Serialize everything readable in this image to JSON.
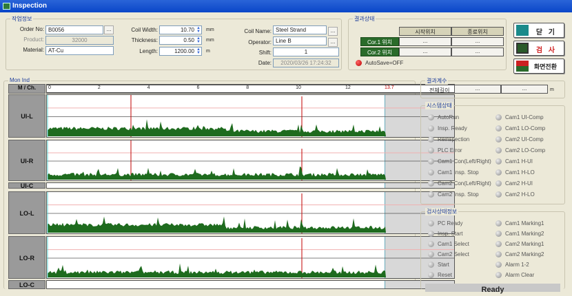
{
  "window": {
    "title": "Inspection"
  },
  "work_info": {
    "title": "작업정보",
    "order_no_label": "Order No:",
    "order_no": "B0056",
    "product_label": "Product:",
    "product": "32000",
    "material_label": "Material:",
    "material": "AT-Cu",
    "width_label": "Coil Width:",
    "width": "10.70",
    "width_unit": "mm",
    "thickness_label": "Thickness:",
    "thickness": "0.50",
    "thickness_unit": "mm",
    "length_label": "Length:",
    "length": "1200.00",
    "length_unit": "m",
    "coil_name_label": "Coil Name:",
    "coil_name": "Steel Strand",
    "operator_label": "Operator:",
    "operator": "Line B",
    "shift_label": "Shift:",
    "shift": "1",
    "date_label": "Date:",
    "date": "2020/03/26 17:24:32",
    "more": "..."
  },
  "result_status": {
    "title": "결과상태",
    "col1": "시작위치",
    "col2": "종료위치",
    "rows": [
      {
        "label": "Cor.1 위치",
        "v1": "...",
        "v2": "..."
      },
      {
        "label": "Cor.2 위치",
        "v1": "...",
        "v2": "..."
      }
    ],
    "indicator": "AutoSave=OFF",
    "indicator_color": "#cc0000"
  },
  "buttons": {
    "close": "닫 기",
    "inspect": "검 사",
    "switch": "화면전환"
  },
  "result_count": {
    "title": "결과계수",
    "label": "전체길이",
    "v1": "...",
    "v2": "...",
    "unit": "m"
  },
  "graph": {
    "title": "Mon Ind",
    "axis_label": "M / Ch.",
    "ticks": [
      "0",
      "2",
      "4",
      "6",
      "8",
      "10",
      "12"
    ],
    "end_tick": "13.7",
    "channels": [
      "UI-L",
      "UI-R",
      "UI-C",
      "LO-L",
      "LO-R",
      "LO-C"
    ],
    "color": "#1e6b1e",
    "marker_color": "#c00000"
  },
  "system_status": {
    "title": "시스템상태",
    "left": [
      "AutoRun",
      "Insp. Ready",
      "Reinspection",
      "PLC Error",
      "Cam1 Con(Left/Right)",
      "Cam1 Insp. Stop",
      "Cam2 Con(Left/Right)",
      "Cam2 Insp. Stop"
    ],
    "right": [
      "Cam1 UI-Comp",
      "Cam1 LO-Comp",
      "Cam2 UI-Comp",
      "Cam2 LO-Comp",
      "Cam1 H-UI",
      "Cam1 H-LO",
      "Cam2 H-UI",
      "Cam2 H-LO"
    ]
  },
  "insp_status": {
    "title": "검사상태정보",
    "left": [
      "PC Ready",
      "Insp. Start",
      "Cam1 Select",
      "Cam2 Select",
      "Start",
      "Reset"
    ],
    "right": [
      "Cam1 Marking1",
      "Cam1 Marking2",
      "Cam2 Marking1",
      "Cam2 Marking2",
      "Alarm 1-2",
      "Alarm Clear"
    ],
    "status": "Ready"
  }
}
